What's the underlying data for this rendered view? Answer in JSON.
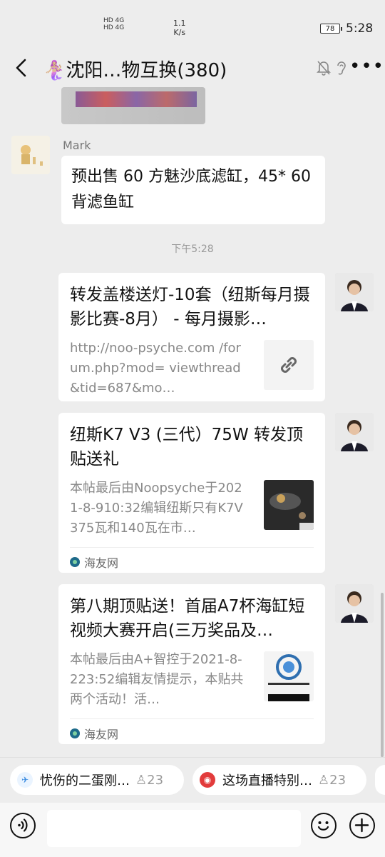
{
  "status_bar": {
    "network_1": "HD 4G",
    "network_2": "HD 4G",
    "speed_value": "1.1",
    "speed_unit": "K/s",
    "battery": "78",
    "time": "5:28"
  },
  "header": {
    "title": "🧜🏼‍♀沈阳…物互换(380)",
    "back_icon": "chevron-left-icon",
    "mute_icon": "bell-off-icon",
    "ear_icon": "ear-icon",
    "more_label": "•••"
  },
  "messages": [
    {
      "type": "text",
      "sender": "Mark",
      "text": "预出售 60 方魅沙底滤缸，45* 60 背滤鱼缸"
    }
  ],
  "timestamp": "下午5:28",
  "cards": [
    {
      "title": "转发盖楼送灯-10套（纽斯每月摄影比赛-8月） - 每月摄影…",
      "desc": "http://noo-psyche.com /forum.php?mod= viewthread&tid=687&mo…",
      "thumb": "link-icon"
    },
    {
      "title": "纽斯K7 V3 (三代）75W 转发顶贴送礼",
      "desc": "本帖最后由Noopsyche于2021-8-910:32编辑纽斯只有K7V375瓦和140瓦在市…",
      "source": "海友网"
    },
    {
      "title": "第八期顶贴送！首届A7杯海缸短视频大赛开启(三万奖品及…",
      "desc": "本帖最后由A+智控于2021-8-223:52编辑友情提示，本贴共两个活动！活…",
      "source": "海友网"
    }
  ],
  "pinned": [
    {
      "label": "忧伤的二蛋刚…",
      "count": "23"
    },
    {
      "label": "这场直播特别…",
      "count": "23"
    }
  ],
  "colors": {
    "background": "#ededed",
    "bubble": "#ffffff",
    "pin_red": "#e23b3b"
  }
}
